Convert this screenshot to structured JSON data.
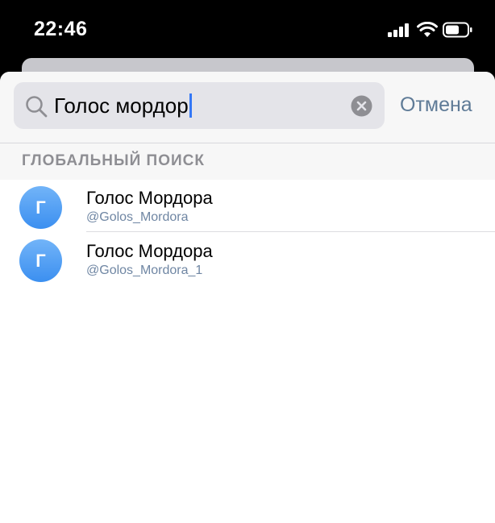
{
  "status_bar": {
    "time": "22:46",
    "icons": [
      "cellular-signal-icon",
      "wifi-icon",
      "battery-icon"
    ]
  },
  "search": {
    "query": "Голос мордор",
    "cancel_label": "Отмена",
    "icons": [
      "search-icon",
      "clear-icon"
    ]
  },
  "section": {
    "title": "ГЛОБАЛЬНЫЙ ПОИСК"
  },
  "results": [
    {
      "avatar_letter": "Г",
      "name": "Голос Мордора",
      "username": "@Golos_Mordora"
    },
    {
      "avatar_letter": "Г",
      "name": "Голос Мордора",
      "username": "@Golos_Mordora_1"
    }
  ],
  "colors": {
    "accent": "#3478f6",
    "cancel": "#5f7b97",
    "avatar_top": "#72b4f8",
    "avatar_bottom": "#3b8ff0",
    "section_header_text": "#8e8e93"
  }
}
